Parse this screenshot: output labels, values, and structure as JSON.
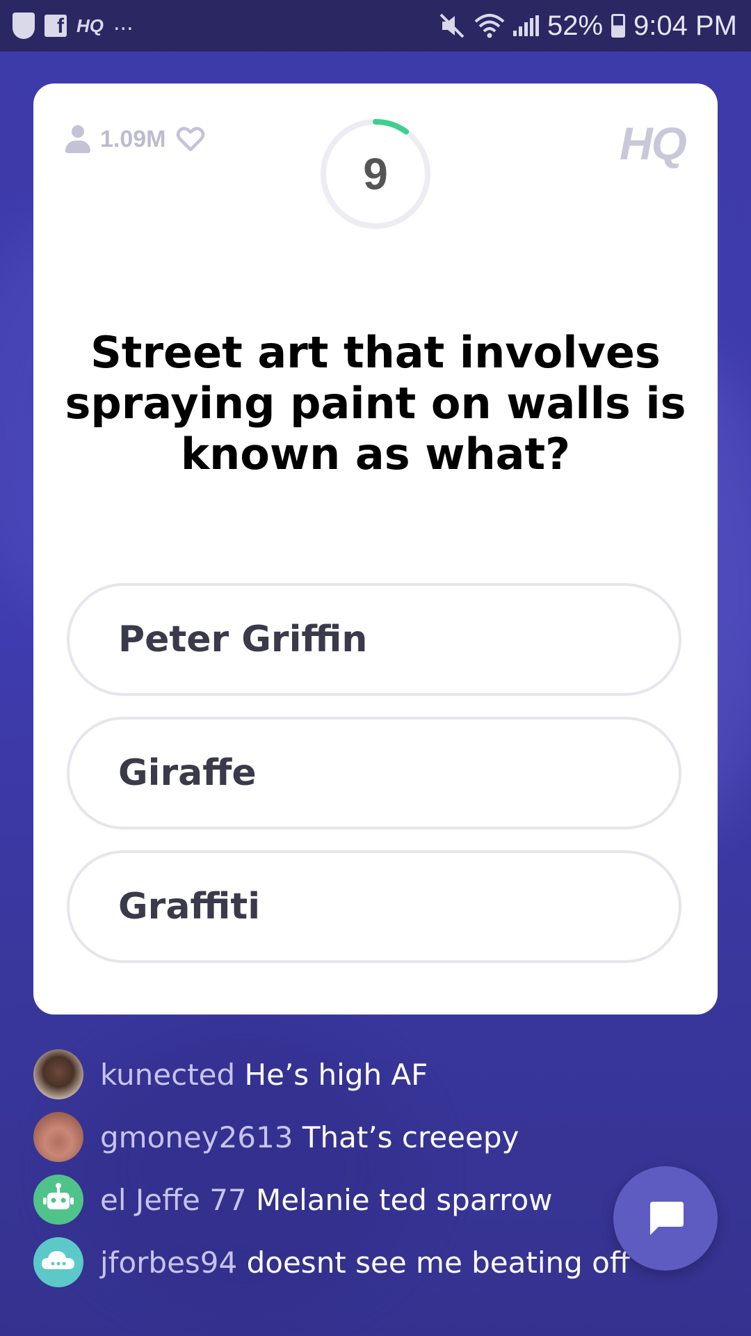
{
  "statusbar": {
    "app_label": "HQ",
    "overflow": "...",
    "battery": "52%",
    "time": "9:04 PM"
  },
  "game": {
    "player_count": "1.09M",
    "timer_value": "9",
    "timer_fraction_remaining": 0.9,
    "logo": "HQ",
    "question": "Street art that involves spraying paint on walls is known as what?",
    "answers": [
      {
        "label": "Peter Griffin"
      },
      {
        "label": "Giraffe"
      },
      {
        "label": "Graffiti"
      }
    ]
  },
  "chat": {
    "messages": [
      {
        "user": "kunected",
        "text": "He’s high AF",
        "avatar": "photo-avatar"
      },
      {
        "user": "gmoney2613",
        "text": "That’s creeepy",
        "avatar": "photo-avatar"
      },
      {
        "user": "el Jeffe 77",
        "text": "Melanie ted sparrow",
        "avatar": "robot-avatar"
      },
      {
        "user": "jforbes94",
        "text": "doesnt see me beating off",
        "avatar": "cloud-avatar"
      }
    ]
  },
  "colors": {
    "background": "#3d3aa8",
    "timer_progress": "#3fcf8e",
    "robot_avatar": "#4fc389",
    "cloud_avatar": "#5cc9c8",
    "chat_button": "#5e5cc1"
  }
}
